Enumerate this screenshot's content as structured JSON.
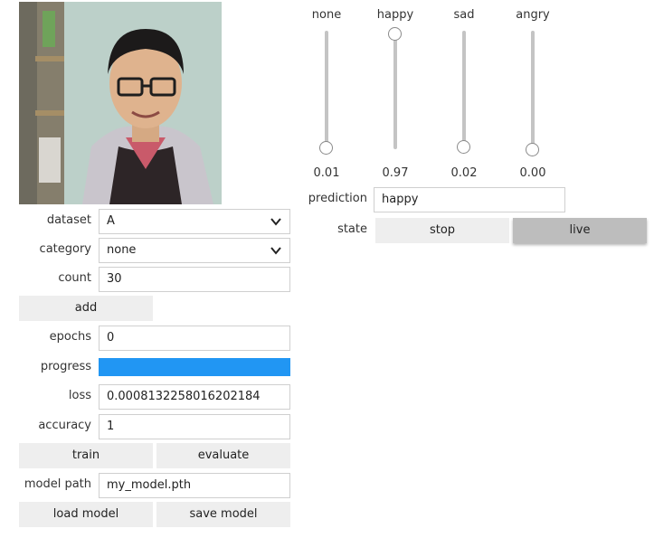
{
  "camera": {
    "alt": "webcam feed"
  },
  "form": {
    "dataset": {
      "label": "dataset",
      "value": "A"
    },
    "category": {
      "label": "category",
      "value": "none"
    },
    "count": {
      "label": "count",
      "value": "30"
    },
    "add_label": "add",
    "epochs": {
      "label": "epochs",
      "value": "0"
    },
    "progress": {
      "label": "progress",
      "value": 1.0
    },
    "loss": {
      "label": "loss",
      "value": "0.0008132258016202184"
    },
    "accuracy": {
      "label": "accuracy",
      "value": "1"
    },
    "train_label": "train",
    "evaluate_label": "evaluate",
    "model_path": {
      "label": "model path",
      "value": "my_model.pth"
    },
    "load_label": "load model",
    "save_label": "save model"
  },
  "sliders": [
    {
      "label": "none",
      "value": "0.01",
      "level": 0.01
    },
    {
      "label": "happy",
      "value": "0.97",
      "level": 0.97
    },
    {
      "label": "sad",
      "value": "0.02",
      "level": 0.02
    },
    {
      "label": "angry",
      "value": "0.00",
      "level": 0.0
    }
  ],
  "prediction": {
    "label": "prediction",
    "value": "happy"
  },
  "state": {
    "label": "state",
    "options": [
      "stop",
      "live"
    ],
    "selected": "live"
  },
  "colors": {
    "progress": "#2196f3",
    "button": "#eeeeee",
    "selected_button": "#bdbdbd"
  }
}
